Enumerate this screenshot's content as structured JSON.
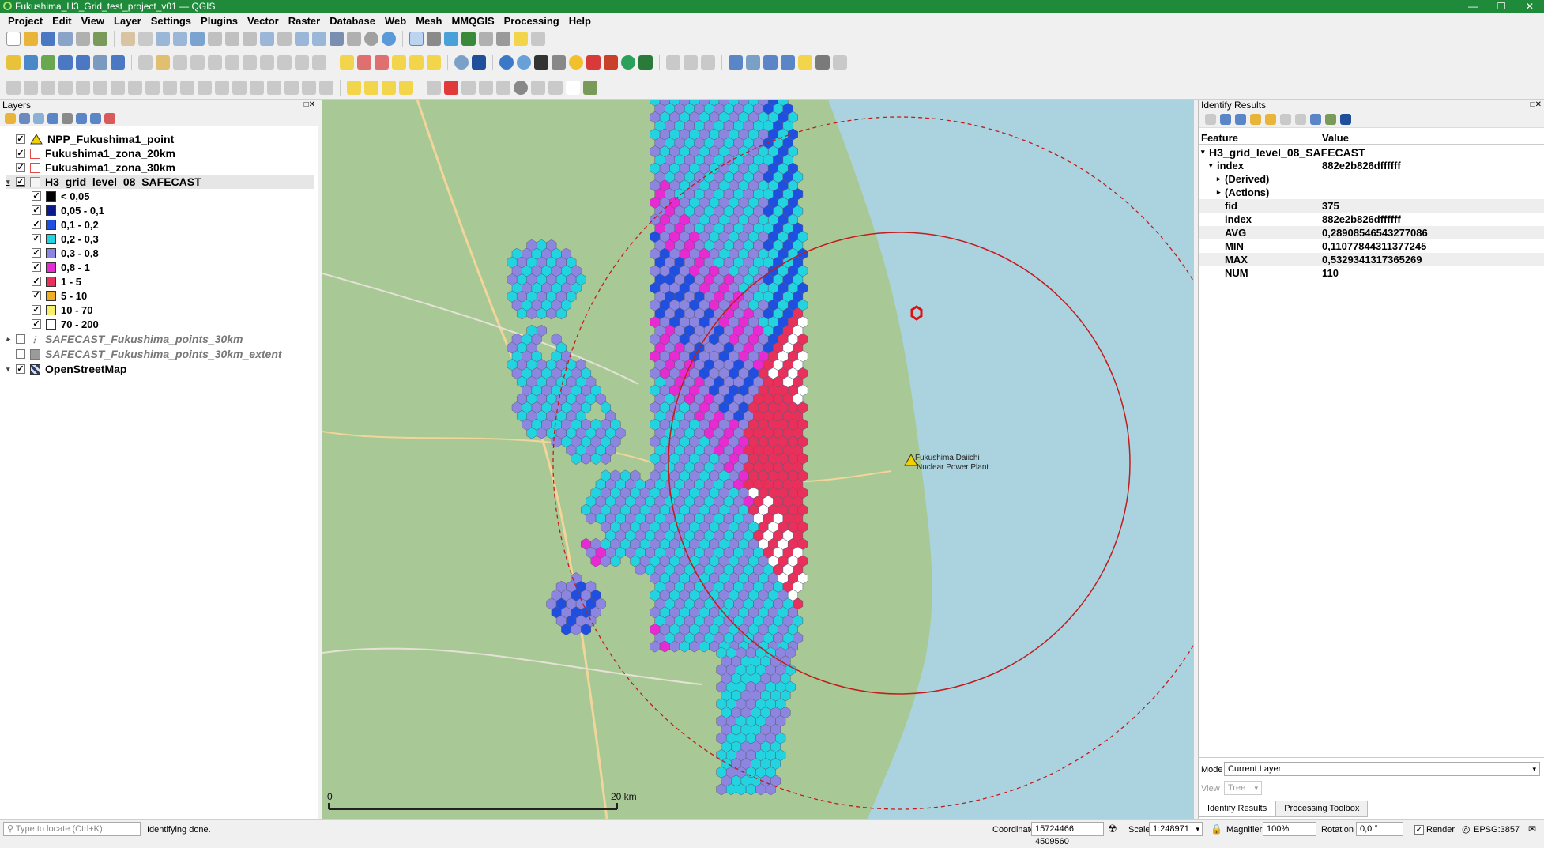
{
  "window": {
    "title": "Fukushima_H3_Grid_test_project_v01 — QGIS"
  },
  "menu": [
    "Project",
    "Edit",
    "View",
    "Layer",
    "Settings",
    "Plugins",
    "Vector",
    "Raster",
    "Database",
    "Web",
    "Mesh",
    "MMQGIS",
    "Processing",
    "Help"
  ],
  "layers_panel": {
    "title": "Layers",
    "layers": [
      {
        "name": "NPP_Fukushima1_point",
        "checked": true
      },
      {
        "name": "Fukushima1_zona_20km",
        "checked": true
      },
      {
        "name": "Fukushima1_zona_30km",
        "checked": true
      },
      {
        "name": "H3_grid_level_08_SAFECAST",
        "checked": true
      },
      {
        "name": "SAFECAST_Fukushima_points_30km",
        "checked": false
      },
      {
        "name": "SAFECAST_Fukushima_points_30km_extent",
        "checked": false
      },
      {
        "name": "OpenStreetMap",
        "checked": true
      }
    ],
    "legend": [
      {
        "label": "< 0,05",
        "color": "#000000"
      },
      {
        "label": "0,05 - 0,1",
        "color": "#0a1a8c"
      },
      {
        "label": "0,1 - 0,2",
        "color": "#1f4fe0"
      },
      {
        "label": "0,2 - 0,3",
        "color": "#22d3e0"
      },
      {
        "label": "0,3 - 0,8",
        "color": "#8c86e0"
      },
      {
        "label": "0,8 - 1",
        "color": "#e82ad2"
      },
      {
        "label": "1 - 5",
        "color": "#e8305a"
      },
      {
        "label": "5 - 10",
        "color": "#f0ae22"
      },
      {
        "label": "10 - 70",
        "color": "#f5ef6a"
      },
      {
        "label": "70 - 200",
        "color": "#ffffff"
      }
    ]
  },
  "map": {
    "label_line1": "Fukushima Daiichi",
    "label_line2": "Nuclear Power Plant",
    "scale_zero": "0",
    "scale_label": "20 km"
  },
  "identify": {
    "title": "Identify Results",
    "col_feature": "Feature",
    "col_value": "Value",
    "layer": "H3_grid_level_08_SAFECAST",
    "root_key": "index",
    "root_value": "882e2b826dffffff",
    "derived": "(Derived)",
    "actions": "(Actions)",
    "attributes": [
      {
        "key": "fid",
        "value": "375"
      },
      {
        "key": "index",
        "value": "882e2b826dffffff"
      },
      {
        "key": "AVG",
        "value": "0,28908546543277086"
      },
      {
        "key": "MIN",
        "value": "0,11077844311377245"
      },
      {
        "key": "MAX",
        "value": "0,5329341317365269"
      },
      {
        "key": "NUM",
        "value": "110"
      }
    ],
    "mode_label": "Mode",
    "mode_value": "Current Layer",
    "view_label": "View",
    "view_value": "Tree",
    "tab_identify": "Identify Results",
    "tab_processing": "Processing Toolbox"
  },
  "status": {
    "locate_placeholder": "Type to locate (Ctrl+K)",
    "message": "Identifying done.",
    "coordinate_label": "Coordinate",
    "coordinate": "15724466 4509560",
    "scale_label": "Scale",
    "scale": "1:248971",
    "magnifier_label": "Magnifier",
    "magnifier": "100%",
    "rotation_label": "Rotation",
    "rotation": "0,0 °",
    "render_label": "Render",
    "crs": "EPSG:3857"
  }
}
